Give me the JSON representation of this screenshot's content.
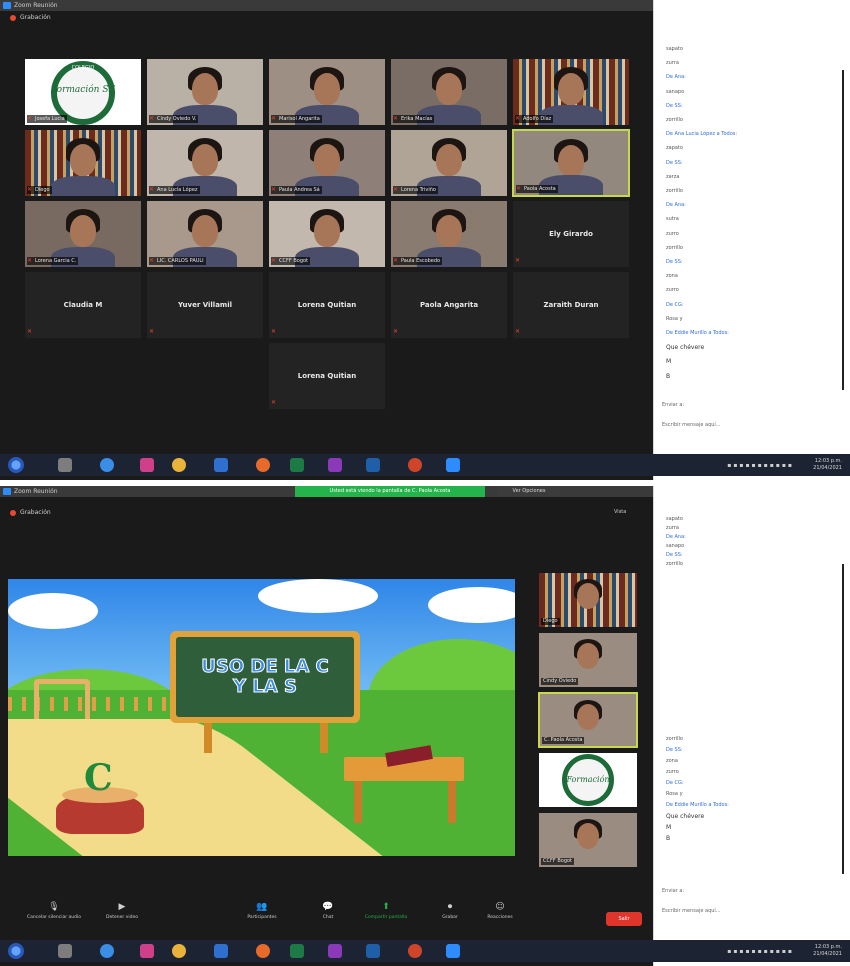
{
  "window_title": "Zoom Reunión",
  "recording_label": "Grabación",
  "gallery": {
    "tiles": [
      {
        "name": "Josefa Lucia",
        "kind": "logo"
      },
      {
        "name": "Cindy Oviedo V.",
        "kind": "video"
      },
      {
        "name": "Marisol Angarita",
        "kind": "video"
      },
      {
        "name": "Erika Macías",
        "kind": "video"
      },
      {
        "name": "Adolfo Díaz",
        "kind": "video"
      },
      {
        "name": "Diego",
        "kind": "video"
      },
      {
        "name": "Ana Lucía López",
        "kind": "video"
      },
      {
        "name": "Paula Andrea Sá",
        "kind": "video"
      },
      {
        "name": "Lorena Triviño",
        "kind": "video"
      },
      {
        "name": "Paola Acosta",
        "kind": "video"
      },
      {
        "name": "Lorena Garcia C.",
        "kind": "video"
      },
      {
        "name": "LIC. CARLOS PAULI",
        "kind": "video"
      },
      {
        "name": "CCFF Bogot",
        "kind": "video"
      },
      {
        "name": "Paula Escobedo",
        "kind": "video"
      },
      {
        "name": "Ely Girardo",
        "kind": "name"
      },
      {
        "name": "Claudia M",
        "kind": "name"
      },
      {
        "name": "Yuver Villamil",
        "kind": "name"
      },
      {
        "name": "Lorena Quitian",
        "kind": "name"
      },
      {
        "name": "Paola Angarita",
        "kind": "name"
      },
      {
        "name": "Zaraith Duran",
        "kind": "name"
      },
      {
        "name": "Lorena Quitian",
        "kind": "name"
      }
    ],
    "logo_text": "Formación",
    "logo_sub": "SE",
    "logo_top": "COLEGIO"
  },
  "chat_top": {
    "lines": [
      {
        "text": "sapato",
        "style": "grey"
      },
      {
        "text": "zurra",
        "style": "grey"
      },
      {
        "text": "De Ana:",
        "style": "blue"
      },
      {
        "text": "sanapo",
        "style": "grey"
      },
      {
        "text": "De SS: ",
        "style": "blue"
      },
      {
        "text": "zorrillo",
        "style": "grey"
      },
      {
        "text": "De Ana Lucia López a Todos:",
        "style": "blue"
      },
      {
        "text": "zapato",
        "style": "grey"
      },
      {
        "text": "De SS: ",
        "style": "blue"
      },
      {
        "text": "zarza",
        "style": "grey"
      },
      {
        "text": "zorrillo",
        "style": "grey"
      },
      {
        "text": "De Ana:",
        "style": "blue"
      },
      {
        "text": "sutra",
        "style": "grey"
      },
      {
        "text": "zurro",
        "style": "grey"
      },
      {
        "text": "zorrillo",
        "style": "grey"
      },
      {
        "text": "De SS: ",
        "style": "blue"
      },
      {
        "text": "zona",
        "style": "grey"
      },
      {
        "text": "zurro",
        "style": "grey"
      },
      {
        "text": "De CG: ",
        "style": "blue"
      },
      {
        "text": "Rosa y",
        "style": "grey"
      },
      {
        "text": "De Eddie Murillo a Todos:",
        "style": "blue"
      },
      {
        "text": "Que chévere",
        "style": "dark"
      },
      {
        "text": "M",
        "style": "dark"
      },
      {
        "text": "B",
        "style": "dark"
      }
    ],
    "send_to": "Enviar a:",
    "input_placeholder": "Escribir mensaje aquí..."
  },
  "chat_bottom": {
    "lines_top": [
      {
        "text": "sapato",
        "style": "grey"
      },
      {
        "text": "zurra",
        "style": "grey"
      },
      {
        "text": "De Ana:",
        "style": "blue"
      },
      {
        "text": "sanapo",
        "style": "grey"
      },
      {
        "text": "De SS: ",
        "style": "blue"
      },
      {
        "text": "zorrillo",
        "style": "grey"
      }
    ],
    "lines_bottom": [
      {
        "text": "zorrillo",
        "style": "grey"
      },
      {
        "text": "De SS: ",
        "style": "blue"
      },
      {
        "text": "zona",
        "style": "grey"
      },
      {
        "text": "zurro",
        "style": "grey"
      },
      {
        "text": "De CG: ",
        "style": "blue"
      },
      {
        "text": "Rosa y",
        "style": "grey"
      },
      {
        "text": "De Eddie Murillo a Todos:",
        "style": "blue"
      },
      {
        "text": "Que chévere",
        "style": "dark"
      },
      {
        "text": "M",
        "style": "dark"
      },
      {
        "text": "B",
        "style": "dark"
      }
    ],
    "send_to": "Enviar a:",
    "input_placeholder": "Escribir mensaje aquí..."
  },
  "share": {
    "banner": "Usted está viendo la pantalla de C. Paola Acosta",
    "options_label": "Ver Opciones",
    "view_label": "Vista"
  },
  "game": {
    "board_line1": "USO DE LA C",
    "board_line2": "Y LA S",
    "letter": "C"
  },
  "side_strip": [
    {
      "name": "Diego"
    },
    {
      "name": "Cindy Oviedo"
    },
    {
      "name": "C. Paola Acosta"
    },
    {
      "name": ""
    },
    {
      "name": "CCFF Bogot"
    }
  ],
  "toolbar": {
    "items": [
      {
        "label": "Cancelar silenciar audio",
        "icon": "mic-icon",
        "glyph": "🎙"
      },
      {
        "label": "Detener video",
        "icon": "camera-icon",
        "glyph": "▶"
      },
      {
        "label": "Participantes",
        "icon": "participants-icon",
        "glyph": "👥"
      },
      {
        "label": "Chat",
        "icon": "chat-icon",
        "glyph": "💬"
      },
      {
        "label": "Compartir pantalla",
        "icon": "share-screen-icon",
        "glyph": "⬆"
      },
      {
        "label": "Grabar",
        "icon": "record-icon",
        "glyph": "⏺"
      },
      {
        "label": "Reacciones",
        "icon": "reactions-icon",
        "glyph": "☺"
      }
    ],
    "end_label": "Salir"
  },
  "tray": {
    "time": "12:03 p.m.",
    "date": "21/04/2021"
  },
  "colors": {
    "zoom_blue": "#2d8cff",
    "active_speaker": "#c6d94a",
    "share_green": "#25b34b",
    "end_red": "#e0352b",
    "mic_muted": "#e8462f"
  }
}
